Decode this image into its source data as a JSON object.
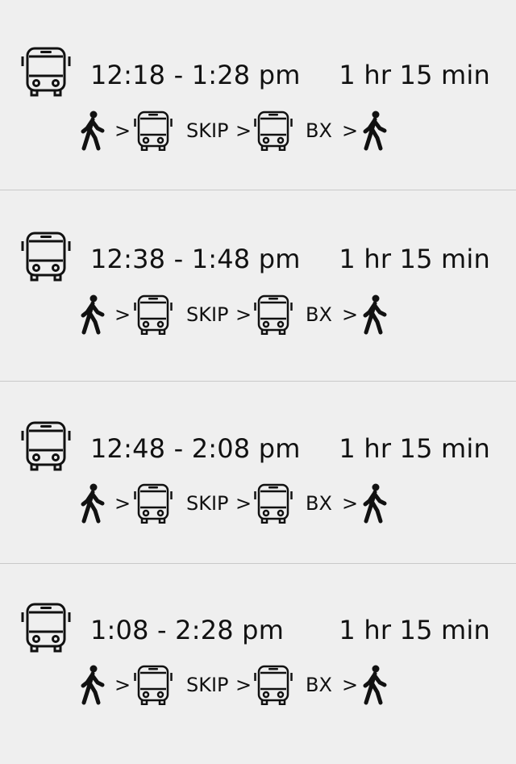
{
  "trips": [
    {
      "time": "12:18 - 1:28 pm",
      "duration": "1 hr 15 min",
      "route": {
        "arrow": ">",
        "lines": [
          "SKIP",
          "BX"
        ]
      }
    },
    {
      "time": "12:38 - 1:48 pm",
      "duration": "1 hr 15 min",
      "route": {
        "arrow": ">",
        "lines": [
          "SKIP",
          "BX"
        ]
      }
    },
    {
      "time": "12:48 - 2:08 pm",
      "duration": "1 hr 15 min",
      "route": {
        "arrow": ">",
        "lines": [
          "SKIP",
          "BX"
        ]
      }
    },
    {
      "time": "1:08 - 2:28 pm",
      "duration": "1 hr 15 min",
      "route": {
        "arrow": ">",
        "lines": [
          "SKIP",
          "BX"
        ]
      }
    }
  ],
  "icons": {
    "trip": "bus-icon",
    "walk": "walk-icon",
    "transit": "bus-icon"
  }
}
